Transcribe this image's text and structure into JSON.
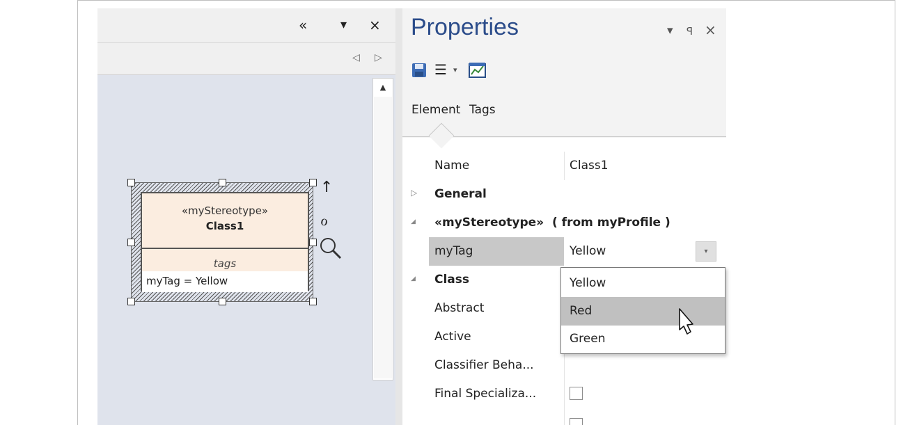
{
  "colors": {
    "canvas_bg": "#dfe3ec",
    "class_fill": "#fbede0",
    "title_blue": "#2b4c8a",
    "selected_row": "#c8c8c8",
    "highlight_item": "#c0c0c0"
  },
  "diagram": {
    "titlebar": {
      "collapse_icon": "«",
      "menu_icon": "▾",
      "close_icon": "×"
    },
    "tabbar": {
      "prev_icon": "◁",
      "next_icon": "▷"
    },
    "scrollbar": {
      "up_icon": "▲"
    },
    "element": {
      "stereotype": "«myStereotype»",
      "name": "Class1",
      "tags_heading": "tags",
      "tag_value": "myTag = Yellow"
    },
    "side_tools": {
      "arrow_icon": "↑",
      "paint_icon": "ℴ",
      "zoom_icon": "🔍"
    }
  },
  "properties": {
    "title": "Properties",
    "title_buttons": {
      "menu_icon": "▾",
      "pin_icon": "ꟼ",
      "close_icon": "×"
    },
    "toolbar": {
      "save_icon": "save-icon",
      "list_icon": "☰",
      "dropdown_icon": "▾",
      "chart_icon": "chart-icon"
    },
    "tabs": [
      {
        "label": "Element"
      },
      {
        "label": "Tags"
      }
    ],
    "rows": [
      {
        "label": "Name",
        "value": "Class1"
      },
      {
        "label": "General",
        "expander": "▷"
      },
      {
        "label": "«myStereotype»  ( from myProfile )",
        "expander": "◢"
      },
      {
        "label": "myTag",
        "value": "Yellow",
        "combo_icon": "▾"
      },
      {
        "label": "Class",
        "expander": "◢"
      },
      {
        "label": "Abstract"
      },
      {
        "label": "Active"
      },
      {
        "label": "Classifier Beha..."
      },
      {
        "label": "Final Specializa..."
      }
    ],
    "dropdown": {
      "items": [
        "Yellow",
        "Red",
        "Green"
      ],
      "highlighted": "Red"
    }
  }
}
